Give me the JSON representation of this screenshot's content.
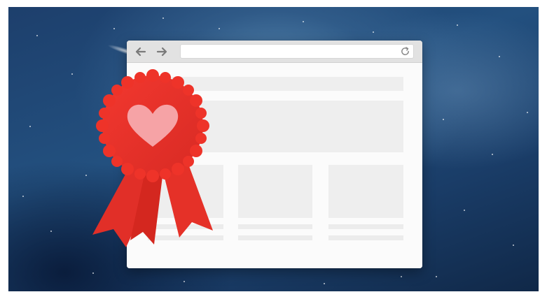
{
  "browser": {
    "back_icon": "arrow-left-icon",
    "forward_icon": "arrow-right-icon",
    "address_value": "",
    "reload_icon": "reload-icon"
  },
  "badge": {
    "icon": "award-ribbon-icon",
    "emblem": "heart-icon",
    "ribbon_color": "#e8302a",
    "heart_color": "#f6a3a6"
  },
  "colors": {
    "background": "#1f4670",
    "window": "#f7f7f7",
    "placeholder": "#eeeeee"
  }
}
